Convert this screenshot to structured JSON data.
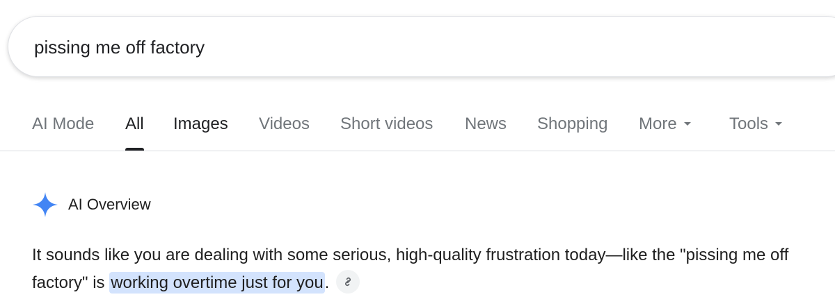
{
  "search": {
    "query": "pissing me off factory"
  },
  "tabs": [
    {
      "label": "AI Mode"
    },
    {
      "label": "All"
    },
    {
      "label": "Images"
    },
    {
      "label": "Videos"
    },
    {
      "label": "Short videos"
    },
    {
      "label": "News"
    },
    {
      "label": "Shopping"
    },
    {
      "label": "More"
    },
    {
      "label": "Tools"
    }
  ],
  "active_tab": "All",
  "ai_overview": {
    "title": "AI Overview",
    "text_before": "It sounds like you are dealing with some serious, high-quality frustration today—like the \"pissing me off factory\" is ",
    "highlighted": "working overtime just for you",
    "text_after": ".",
    "link_icon": "link-icon"
  },
  "colors": {
    "accent_blue": "#4285f4",
    "highlight": "#d3e3fd",
    "text_primary": "#202124",
    "text_secondary": "#70757a"
  }
}
